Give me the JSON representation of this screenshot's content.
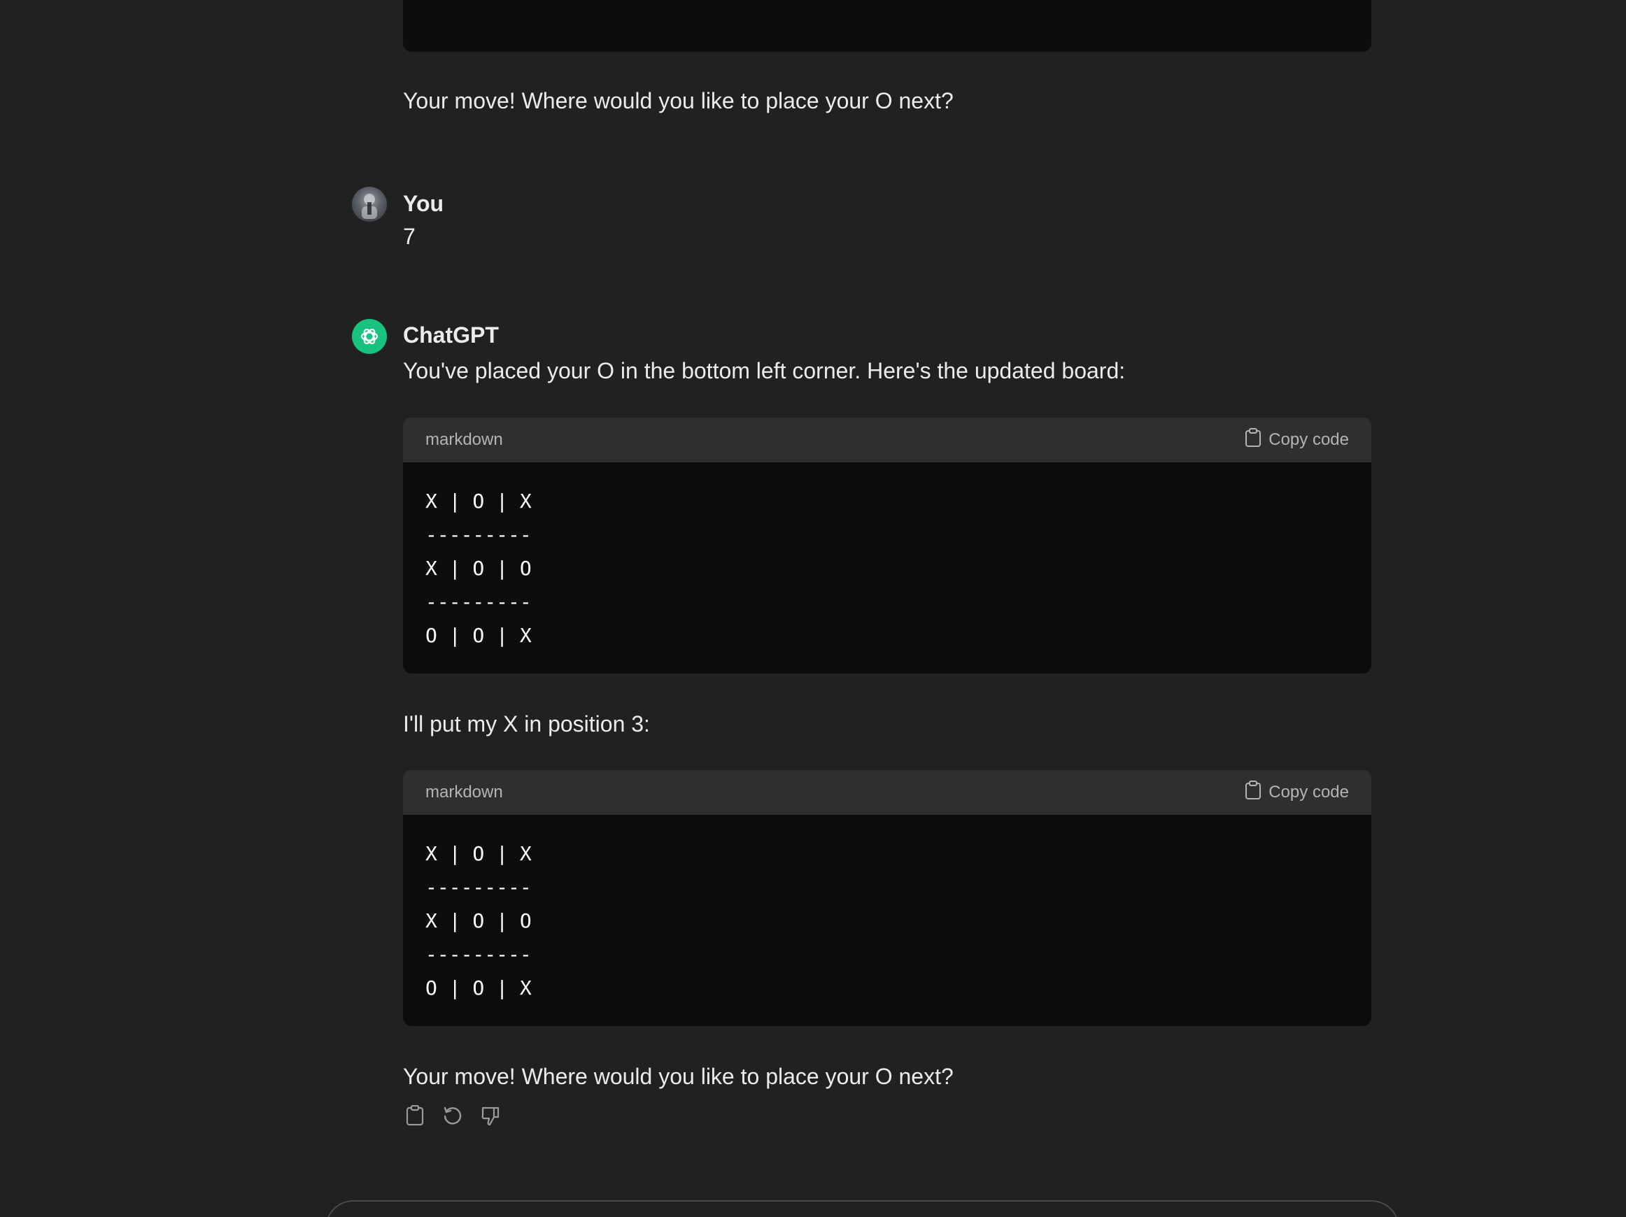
{
  "messages": {
    "prev_assistant_text": "Your move! Where would you like to place your O next?",
    "user": {
      "author": "You",
      "text": "7"
    },
    "assistant": {
      "author": "ChatGPT",
      "intro": "You've placed your O in the bottom left corner. Here's the updated board:",
      "code1": {
        "language": "markdown",
        "copy_label": "Copy code",
        "lines": [
          "X | O | X",
          "---------",
          "X | O | O",
          "---------",
          "O | O | X"
        ]
      },
      "middle": "I'll put my X in position 3:",
      "code2": {
        "language": "markdown",
        "copy_label": "Copy code",
        "lines": [
          "X | O | X",
          "---------",
          "X | O | O",
          "---------",
          "O | O | X"
        ]
      },
      "outro": "Your move! Where would you like to place your O next?"
    }
  },
  "icons": {
    "copy": "clipboard-icon",
    "regenerate": "regenerate-icon",
    "dislike": "thumbs-down-icon",
    "assistant_logo": "openai-logo-icon"
  },
  "colors": {
    "background": "#212121",
    "code_background": "#0d0d0d",
    "code_header": "#2f2f2f",
    "assistant_avatar": "#19c37d",
    "text": "#ececec"
  }
}
